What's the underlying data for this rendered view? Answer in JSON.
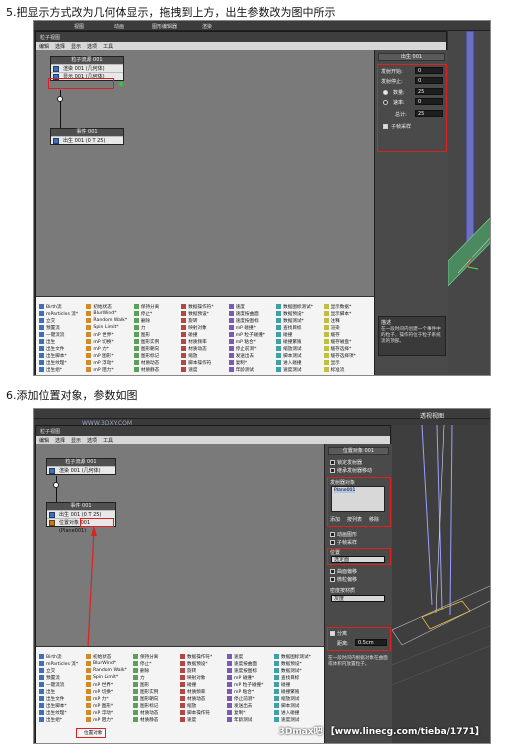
{
  "step5": {
    "title": "5.把显示方式改为几何体显示，拖拽到上方，出生参数改为图中所示",
    "window": {
      "title": "粒子视图",
      "menu": [
        "编辑",
        "选择",
        "显示",
        "选项",
        "工具"
      ]
    },
    "top_tabs": [
      "视图",
      "动画",
      "图形编辑器",
      "渲染"
    ],
    "event1": {
      "header": "粒子流源 001",
      "rows": [
        "渲染 001 (几何体)",
        "显示 001 (几何体)"
      ]
    },
    "event2": {
      "header": "事件 001",
      "rows": [
        "出生 001 (0 T 25)"
      ]
    },
    "panel": {
      "title": "出生 001",
      "fields": [
        {
          "label": "发射开始:",
          "value": "0"
        },
        {
          "label": "发射停止:",
          "value": "0"
        }
      ],
      "radio_rows": [
        {
          "label": "数量:",
          "value": "25",
          "selected": true
        },
        {
          "label": "速率:",
          "value": "0",
          "selected": false
        }
      ],
      "total_label": "总计:",
      "total_value": "25",
      "checkbox_label": "子帧采样",
      "checkbox_checked": true,
      "desc_title": "描述",
      "desc": "在一段时间内创建一个事件中的粒子，操作符位于粒子系统流的顶部。"
    },
    "depot_columns": [
      [
        "Birth流",
        "mParticles 流*",
        "立交",
        "预置流",
        "一键流流",
        "出生",
        "出生文件",
        "出生脚本*",
        "出生纹理*",
        "出生组*"
      ],
      [
        "初始状态",
        "BlurWind*",
        "Random Walk*",
        "Spin Limit*",
        "mP 世界*",
        "mP 切换*",
        "mP 力*",
        "mP 图形*",
        "mP 浮动*",
        "mP 阻力*"
      ],
      [
        "保持分离",
        "停止*",
        "删除",
        "力",
        "图形",
        "图形实例",
        "图形朝向",
        "图形标记",
        "材质动态",
        "材质静态"
      ],
      [
        "数据操作符*",
        "数据预设*",
        "旋转",
        "映射对象",
        "碰撞",
        "材质频率",
        "材质动态",
        "缩放",
        "脚本操作符",
        "速度"
      ],
      [
        "速度",
        "速度按曲面",
        "速度按图标",
        "mP 碰撞*",
        "mP 粒子碰撞*",
        "mP 粘合*",
        "停止前测*",
        "发送出去",
        "复制*",
        "年龄测试"
      ],
      [
        "数据图标测试*",
        "数据预设*",
        "数据测试*",
        "查找目标",
        "碰撞",
        "碰撞繁殖",
        "缩放测试",
        "脚本测试",
        "进入碰撞",
        "速度测试"
      ],
      [
        "显示数据*",
        "显示脚本*",
        "注释",
        "渲染",
        "缓存",
        "缓存磁盘*",
        "缓存选择*",
        "缓存选择项*",
        "显示",
        "标准流"
      ]
    ]
  },
  "step6": {
    "title": "6.添加位置对象，参数如图",
    "site_watermark": "WWW.3DXY.COM",
    "view_label": "透视视图",
    "window": {
      "title": "粒子视图",
      "menu": [
        "编辑",
        "选择",
        "显示",
        "选项",
        "工具"
      ]
    },
    "event1": {
      "header": "粒子流源 001",
      "rows": [
        "渲染 001 (几何体)"
      ]
    },
    "event2": {
      "header": "事件 001",
      "rows": [
        "出生 001 (0 T 25)",
        "位置对象 001 (Plane001)"
      ]
    },
    "panel": {
      "title": "位置对象 001",
      "checkboxes": [
        "锁定发射器",
        "继承发射器移动"
      ],
      "emitter_group": "发射器对象",
      "list_item": "Plane001",
      "list_buttons": [
        "添加",
        "按列表",
        "移除"
      ],
      "checkboxes2": [
        "动画图形",
        "子帧采样"
      ],
      "location_group": "位置",
      "location_value": "选定面",
      "surface_offset": "曲面偏移",
      "offset_checkbox": "微粒偏移",
      "density_label": "密度按材质",
      "density_value": "灰度",
      "separation_checkbox": "分离",
      "separation_label": "距离:",
      "separation_value": "0.5cm",
      "desc": "在一段时间内根据对象在曲面或体积内放置粒子。"
    },
    "depot_highlight": "位置对象",
    "footer_watermark": "3Dmax吧 【www.linecg.com/tieba/1771】"
  },
  "colors": {
    "highlight": "#e02020",
    "node_icon": "#3f6fb5",
    "grid": "#5fc080",
    "emitter": "#7070d0"
  }
}
